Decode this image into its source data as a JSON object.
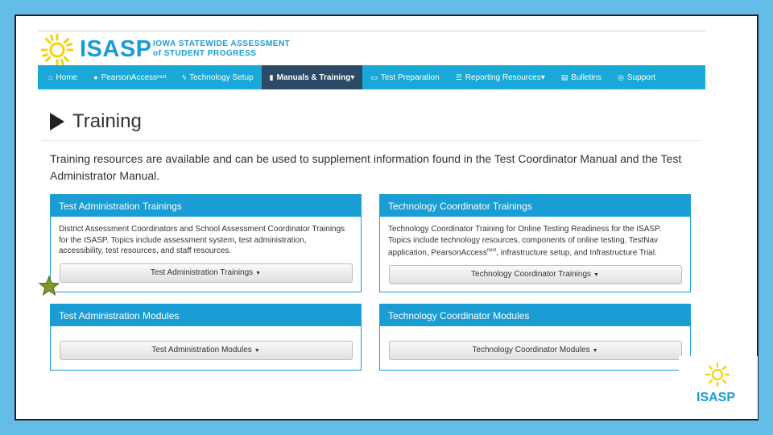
{
  "brand": {
    "name": "ISASP",
    "tagline_line1": "IOWA STATEWIDE ASSESSMENT",
    "tagline_line2": "of STUDENT PROGRESS",
    "color": "#1a9cd4",
    "sun_color": "#f5d20a"
  },
  "nav": {
    "items": [
      {
        "icon": "home-icon",
        "label": "Home"
      },
      {
        "icon": "globe-icon",
        "label": "PearsonAccess",
        "sup": "next"
      },
      {
        "icon": "bolt-icon",
        "label": "Technology Setup"
      },
      {
        "icon": "book-icon",
        "label": "Manuals & Training",
        "caret": "▾"
      },
      {
        "icon": "monitor-icon",
        "label": "Test Preparation"
      },
      {
        "icon": "list-icon",
        "label": "Reporting Resources",
        "caret": "▾"
      },
      {
        "icon": "newspaper-icon",
        "label": "Bulletins"
      },
      {
        "icon": "lifebuoy-icon",
        "label": "Support"
      }
    ],
    "active_index": 3
  },
  "page": {
    "title": "Training",
    "intro": "Training resources are available and can be used to supplement information found in the Test Coordinator Manual and the Test Administrator Manual."
  },
  "panels": {
    "test_admin_trainings": {
      "title": "Test Administration Trainings",
      "body": "District Assessment Coordinators and School Assessment Coordinator Trainings for the ISASP. Topics include assessment system, test administration, accessibility, test resources, and staff resources.",
      "button": "Test Administration Trainings"
    },
    "tech_coord_trainings": {
      "title": "Technology Coordinator Trainings",
      "body_pre": "Technology Coordinator Training for Online Testing Readiness for the ISASP. Topics include technology resources, components of online testing, TestNav application, PearsonAccess",
      "body_sup": "next",
      "body_post": ", infrastructure setup, and Infrastructure Trial.",
      "button": "Technology Coordinator Trainings"
    },
    "test_admin_modules": {
      "title": "Test Administration Modules",
      "button": "Test Administration Modules"
    },
    "tech_coord_modules": {
      "title": "Technology Coordinator Modules",
      "button": "Technology Coordinator Modules"
    }
  },
  "corner_logo": {
    "name": "ISASP"
  },
  "colors": {
    "background": "#63bde8",
    "nav_bg": "#1aa8d8",
    "nav_active": "#2c4a66",
    "star": "#7a9a2a"
  }
}
